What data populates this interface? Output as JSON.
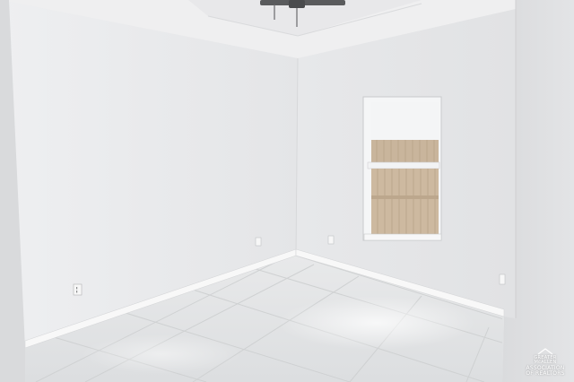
{
  "scene": {
    "description_free": true,
    "colors": {
      "wall_left": "#ecedef",
      "wall_back": "#e6e7e9",
      "wall_right": "#dfe0e2",
      "ceiling": "#efeff0",
      "baseboard": "#f8f8f8",
      "floor": "#e3e5e6",
      "tile_grout": "#cfd1d2",
      "window_frame": "#f5f6f7",
      "sky": "#f4f5f6",
      "fence": "#cdb9a0"
    }
  },
  "watermark": {
    "line1": "GREATER McALLEN",
    "line2": "ASSOCIATION OF REALTORS"
  }
}
